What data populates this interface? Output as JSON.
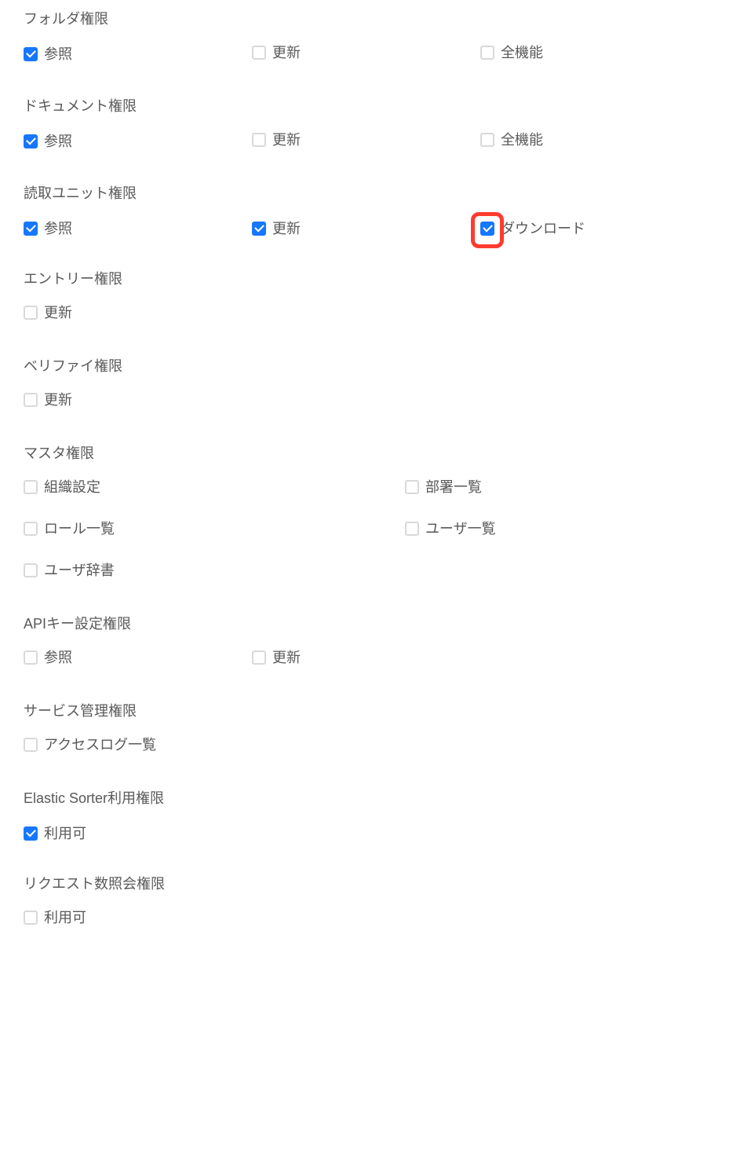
{
  "sections": {
    "folder": {
      "title": "フォルダ権限",
      "items": [
        "参照",
        "更新",
        "全機能"
      ],
      "checked": [
        true,
        false,
        false
      ]
    },
    "document": {
      "title": "ドキュメント権限",
      "items": [
        "参照",
        "更新",
        "全機能"
      ],
      "checked": [
        true,
        false,
        false
      ]
    },
    "readunit": {
      "title": "読取ユニット権限",
      "items": [
        "参照",
        "更新",
        "ダウンロード"
      ],
      "checked": [
        true,
        true,
        true
      ]
    },
    "entry": {
      "title": "エントリー権限",
      "items": [
        "更新"
      ],
      "checked": [
        false
      ]
    },
    "verify": {
      "title": "ベリファイ権限",
      "items": [
        "更新"
      ],
      "checked": [
        false
      ]
    },
    "master": {
      "title": "マスタ権限",
      "items": [
        "組織設定",
        "部署一覧",
        "ロール一覧",
        "ユーザ一覧",
        "ユーザ辞書"
      ],
      "checked": [
        false,
        false,
        false,
        false,
        false
      ]
    },
    "apikey": {
      "title": "APIキー設定権限",
      "items": [
        "参照",
        "更新"
      ],
      "checked": [
        false,
        false
      ]
    },
    "service": {
      "title": "サービス管理権限",
      "items": [
        "アクセスログ一覧"
      ],
      "checked": [
        false
      ]
    },
    "elastic": {
      "title": "Elastic Sorter利用権限",
      "items": [
        "利用可"
      ],
      "checked": [
        true
      ]
    },
    "request": {
      "title": "リクエスト数照会権限",
      "items": [
        "利用可"
      ],
      "checked": [
        false
      ]
    }
  },
  "highlight": "readunit.2"
}
